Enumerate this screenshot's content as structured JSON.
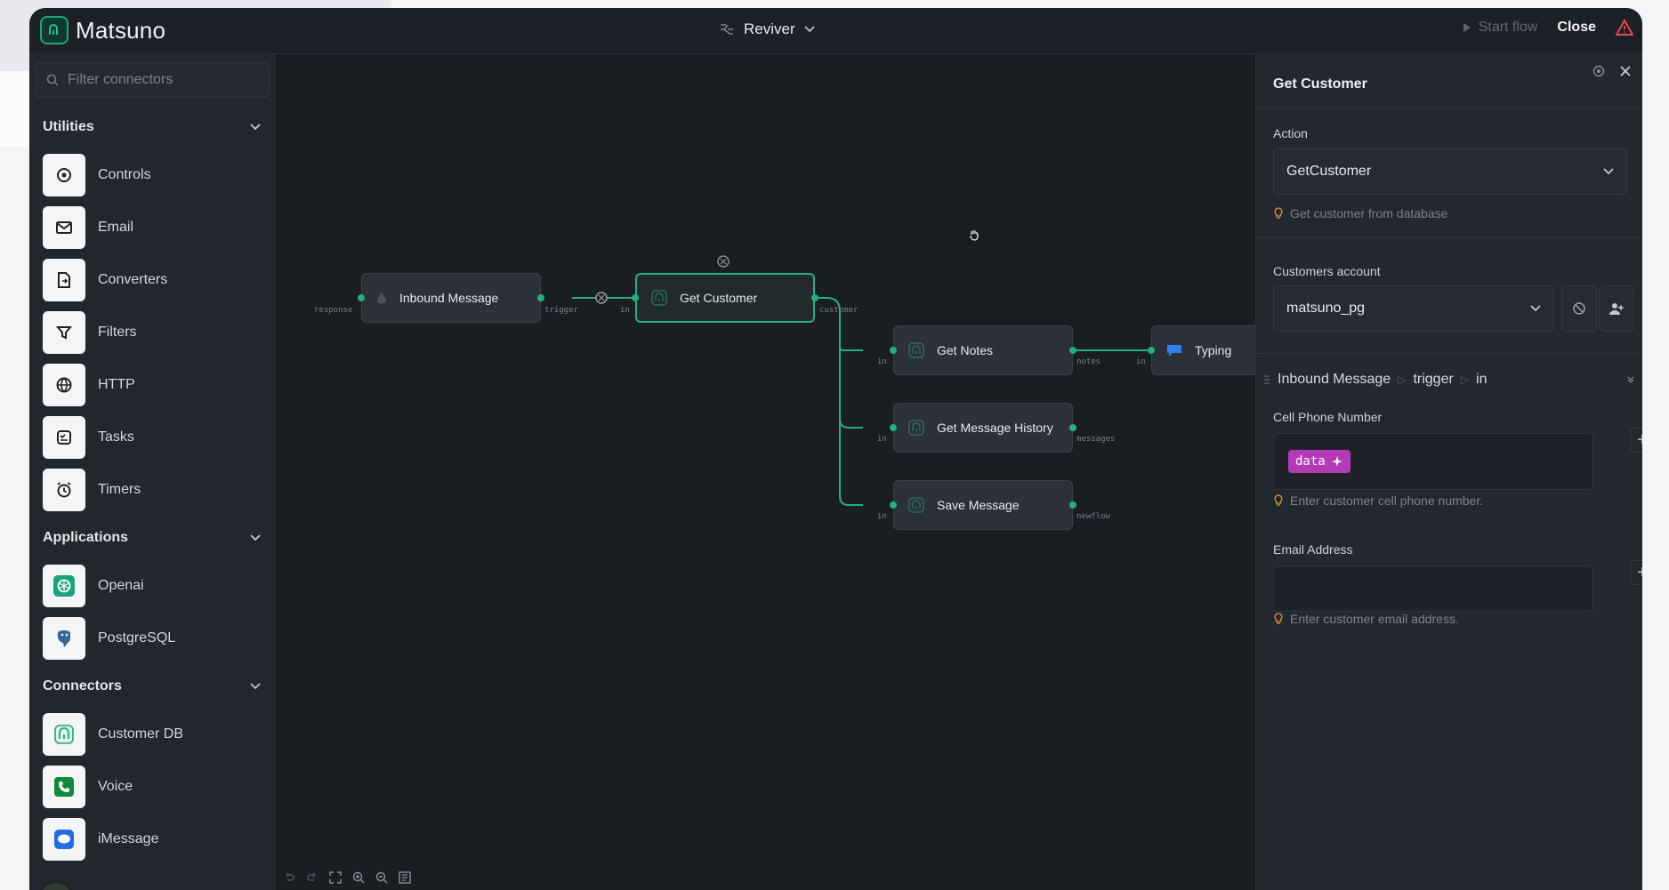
{
  "app": {
    "name": "Matsuno"
  },
  "header": {
    "flow_name": "Reviver",
    "start_flow_label": "Start flow",
    "close_label": "Close"
  },
  "sidebar": {
    "search_placeholder": "Filter connectors",
    "sections": [
      {
        "title": "Utilities",
        "items": [
          "Controls",
          "Email",
          "Converters",
          "Filters",
          "HTTP",
          "Tasks",
          "Timers"
        ]
      },
      {
        "title": "Applications",
        "items": [
          "Openai",
          "PostgreSQL"
        ]
      },
      {
        "title": "Connectors",
        "items": [
          "Customer DB",
          "Voice",
          "iMessage"
        ]
      }
    ]
  },
  "canvas": {
    "nodes": {
      "inbound": "Inbound Message",
      "get_customer": "Get Customer",
      "get_notes": "Get Notes",
      "get_history": "Get Message History",
      "save_message": "Save Message",
      "typing": "Typing"
    },
    "ports": {
      "response": "response",
      "trigger": "trigger",
      "in": "in",
      "customer": "customer",
      "notes": "notes",
      "messages": "messages",
      "newflow": "newflow"
    }
  },
  "panel": {
    "title": "Get Customer",
    "action_label": "Action",
    "action_value": "GetCustomer",
    "action_hint": "Get customer from database",
    "account_label": "Customers account",
    "account_value": "matsuno_pg",
    "breadcrumb": [
      "Inbound Message",
      "trigger",
      "in"
    ],
    "phone_label": "Cell Phone Number",
    "phone_chip": "data",
    "phone_hint": "Enter customer cell phone number.",
    "email_label": "Email Address",
    "email_hint": "Enter customer email address."
  },
  "colors": {
    "accent": "#22b07e",
    "chip": "#b43ab9",
    "warning": "#e5484d",
    "typing_icon": "#2f80ed"
  }
}
